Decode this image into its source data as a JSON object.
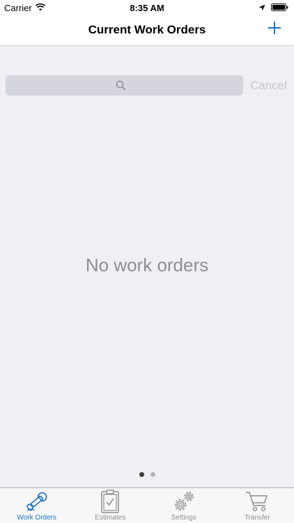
{
  "status_bar": {
    "carrier": "Carrier",
    "time": "8:35 AM"
  },
  "nav": {
    "title": "Current Work Orders",
    "add_icon": "plus-icon"
  },
  "search": {
    "value": "",
    "placeholder": "",
    "icon": "search-icon",
    "cancel_label": "Cancel"
  },
  "main": {
    "empty_message": "No work orders"
  },
  "pager": {
    "page_count": 2,
    "current_page": 1
  },
  "tab_bar": {
    "tabs": [
      {
        "label": "Work Orders",
        "icon": "wrench-icon",
        "selected": true
      },
      {
        "label": "Estimates",
        "icon": "clipboard-icon",
        "selected": false
      },
      {
        "label": "Settings",
        "icon": "gears-icon",
        "selected": false
      },
      {
        "label": "Transfer",
        "icon": "cart-icon",
        "selected": false
      }
    ]
  },
  "colors": {
    "accent": "#1a73c9",
    "background": "#efeff4",
    "muted_text": "#8e8e93"
  }
}
